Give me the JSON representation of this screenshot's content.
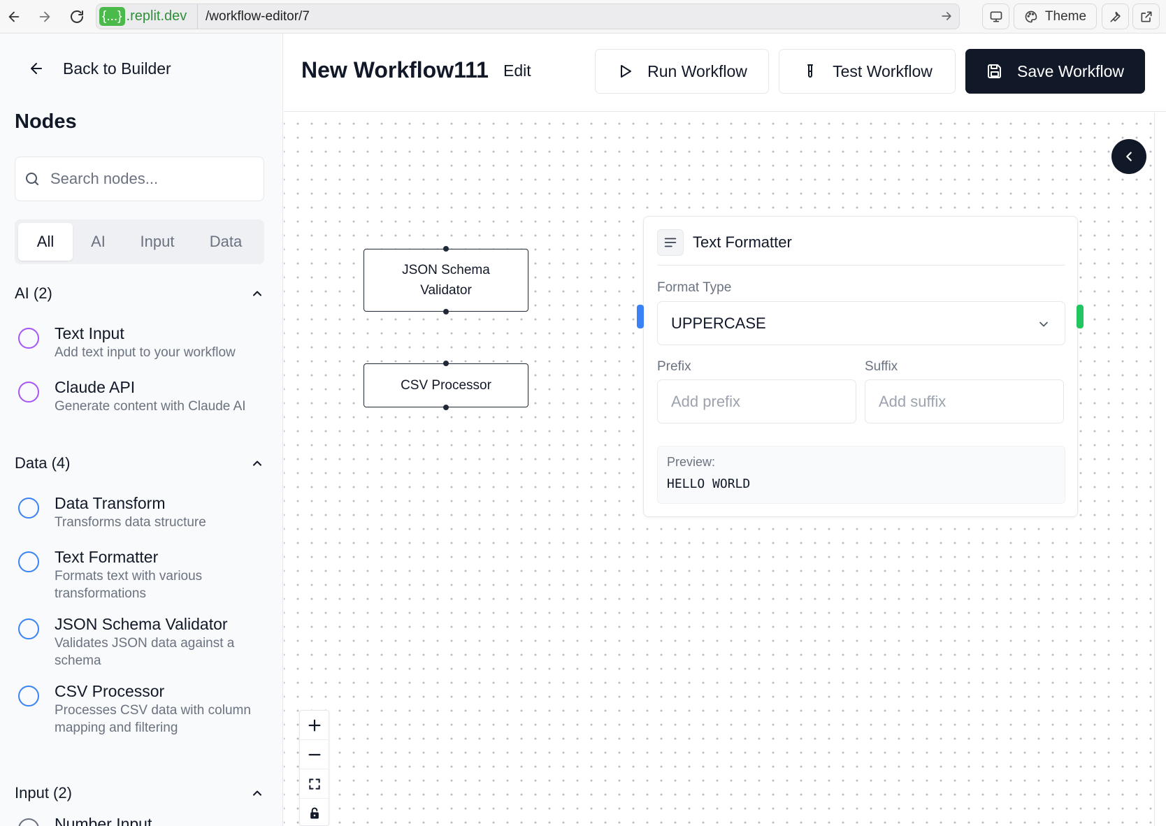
{
  "browser": {
    "url_host_chip": "{...}",
    "url_host": ".replit.dev",
    "url_path": "/workflow-editor/7",
    "theme_label": "Theme"
  },
  "sidebar": {
    "back_label": "Back to Builder",
    "title": "Nodes",
    "search_placeholder": "Search nodes...",
    "tabs": [
      {
        "label": "All",
        "active": true
      },
      {
        "label": "AI",
        "active": false
      },
      {
        "label": "Input",
        "active": false
      },
      {
        "label": "Data",
        "active": false
      }
    ],
    "sections": [
      {
        "title": "AI (2)",
        "color": "#a855f7",
        "items": [
          {
            "title": "Text Input",
            "description": "Add text input to your workflow"
          },
          {
            "title": "Claude API",
            "description": "Generate content with Claude AI"
          }
        ]
      },
      {
        "title": "Data (4)",
        "color": "#3b82f6",
        "items": [
          {
            "title": "Data Transform",
            "description": "Transforms data structure"
          },
          {
            "title": "Text Formatter",
            "description": "Formats text with various transformations"
          },
          {
            "title": "JSON Schema Validator",
            "description": "Validates JSON data against a schema"
          },
          {
            "title": "CSV Processor",
            "description": "Processes CSV data with column mapping and filtering"
          }
        ]
      },
      {
        "title": "Input (2)",
        "color": "#6b7280",
        "items": [
          {
            "title": "Number Input",
            "description": ""
          }
        ]
      }
    ]
  },
  "header": {
    "workflow_name": "New Workflow111",
    "edit_label": "Edit",
    "run_label": "Run Workflow",
    "test_label": "Test Workflow",
    "save_label": "Save Workflow"
  },
  "canvas": {
    "nodes": {
      "json_validator": "JSON Schema Validator",
      "csv_processor": "CSV Processor"
    },
    "text_formatter": {
      "title": "Text Formatter",
      "format_type_label": "Format Type",
      "format_type_value": "UPPERCASE",
      "prefix_label": "Prefix",
      "prefix_placeholder": "Add prefix",
      "suffix_label": "Suffix",
      "suffix_placeholder": "Add suffix",
      "preview_label": "Preview:",
      "preview_value": "HELLO WORLD",
      "input_handle_color": "#3b82f6",
      "output_handle_color": "#22c55e"
    }
  },
  "colors": {
    "primary_dark": "#111827",
    "url_chip_green": "#4aba4a"
  }
}
